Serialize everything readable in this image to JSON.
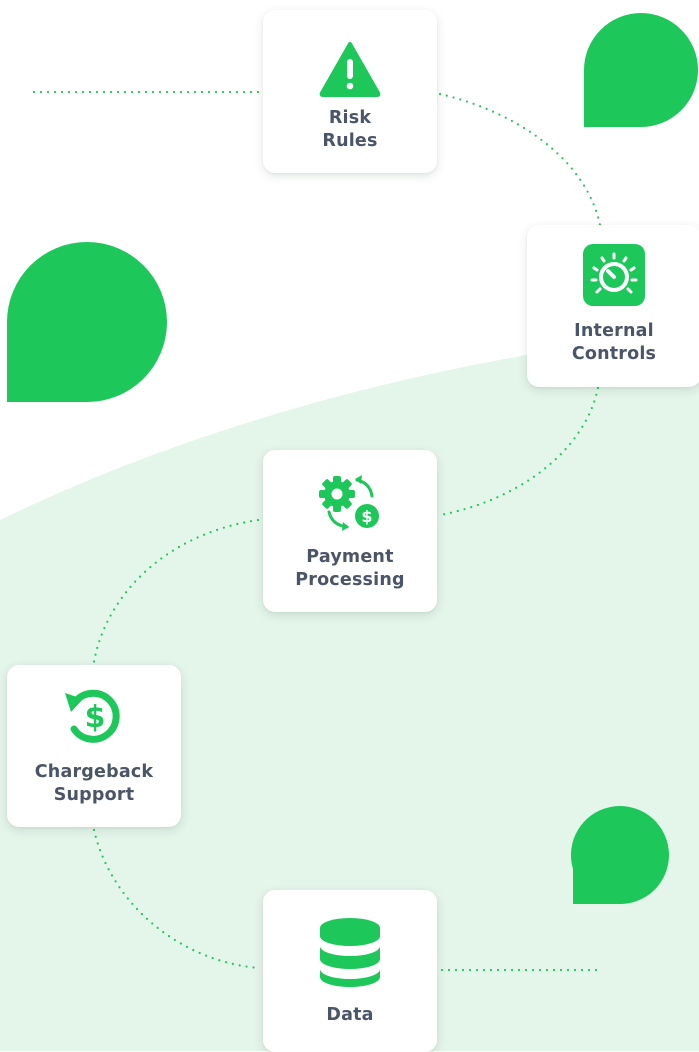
{
  "colors": {
    "accent": "#1ec75a",
    "label": "#4a5568",
    "panel": "#e4f5ea"
  },
  "nodes": {
    "risk_rules": {
      "line1": "Risk",
      "line2": "Rules",
      "icon": "warning-triangle-icon"
    },
    "internal_controls": {
      "line1": "Internal",
      "line2": "Controls",
      "icon": "control-dial-icon"
    },
    "payment_processing": {
      "line1": "Payment",
      "line2": "Processing",
      "icon": "gear-dollar-cycle-icon"
    },
    "chargeback_support": {
      "line1": "Chargeback",
      "line2": "Support",
      "icon": "refund-dollar-icon"
    },
    "data": {
      "line1": "Data",
      "icon": "database-icon"
    }
  }
}
